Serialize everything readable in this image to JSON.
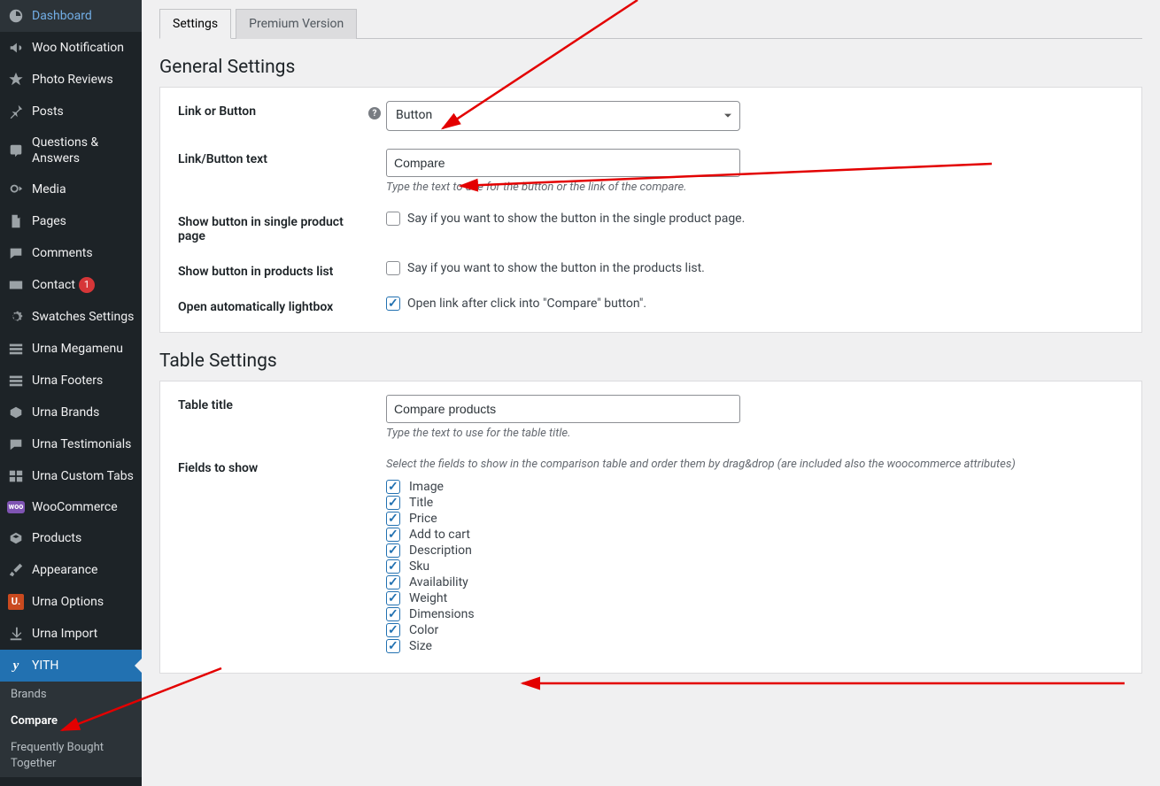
{
  "sidebar": {
    "items": [
      {
        "label": "Dashboard",
        "icon": "dashboard"
      },
      {
        "label": "Woo Notification",
        "icon": "megaphone"
      },
      {
        "label": "Photo Reviews",
        "icon": "star"
      },
      {
        "label": "Posts",
        "icon": "pin"
      },
      {
        "label": "Questions & Answers",
        "icon": "qa"
      },
      {
        "label": "Media",
        "icon": "media"
      },
      {
        "label": "Pages",
        "icon": "pages"
      },
      {
        "label": "Comments",
        "icon": "comments"
      },
      {
        "label": "Contact",
        "icon": "mail",
        "badge": "1"
      },
      {
        "label": "Swatches Settings",
        "icon": "gear"
      },
      {
        "label": "Urna Megamenu",
        "icon": "grid"
      },
      {
        "label": "Urna Footers",
        "icon": "grid"
      },
      {
        "label": "Urna Brands",
        "icon": "brands"
      },
      {
        "label": "Urna Testimonials",
        "icon": "testimonial"
      },
      {
        "label": "Urna Custom Tabs",
        "icon": "tabs"
      },
      {
        "label": "WooCommerce",
        "icon": "woo"
      },
      {
        "label": "Products",
        "icon": "products"
      },
      {
        "label": "Appearance",
        "icon": "brush"
      },
      {
        "label": "Urna Options",
        "icon": "u-red"
      },
      {
        "label": "Urna Import",
        "icon": "import"
      },
      {
        "label": "YITH",
        "icon": "yith"
      }
    ],
    "submenu": [
      {
        "label": "Brands"
      },
      {
        "label": "Compare",
        "current": true
      },
      {
        "label": "Frequently Bought Together"
      }
    ]
  },
  "tabs": {
    "settings": "Settings",
    "premium": "Premium Version"
  },
  "general": {
    "heading": "General Settings",
    "link_or_button": {
      "label": "Link or Button",
      "value": "Button"
    },
    "link_button_text": {
      "label": "Link/Button text",
      "value": "Compare",
      "desc": "Type the text to use for the button or the link of the compare."
    },
    "show_single": {
      "label": "Show button in single product page",
      "desc": "Say if you want to show the button in the single product page.",
      "checked": false
    },
    "show_list": {
      "label": "Show button in products list",
      "desc": "Say if you want to show the button in the products list.",
      "checked": false
    },
    "open_lightbox": {
      "label": "Open automatically lightbox",
      "desc": "Open link after click into \"Compare\" button\".",
      "checked": true
    }
  },
  "table": {
    "heading": "Table Settings",
    "title": {
      "label": "Table title",
      "value": "Compare products",
      "desc": "Type the text to use for the table title."
    },
    "fields": {
      "label": "Fields to show",
      "desc": "Select the fields to show in the comparison table and order them by drag&drop (are included also the woocommerce attributes)",
      "items": [
        {
          "label": "Image",
          "checked": true
        },
        {
          "label": "Title",
          "checked": true
        },
        {
          "label": "Price",
          "checked": true
        },
        {
          "label": "Add to cart",
          "checked": true
        },
        {
          "label": "Description",
          "checked": true
        },
        {
          "label": "Sku",
          "checked": true
        },
        {
          "label": "Availability",
          "checked": true
        },
        {
          "label": "Weight",
          "checked": true
        },
        {
          "label": "Dimensions",
          "checked": true
        },
        {
          "label": "Color",
          "checked": true
        },
        {
          "label": "Size",
          "checked": true
        }
      ]
    }
  }
}
